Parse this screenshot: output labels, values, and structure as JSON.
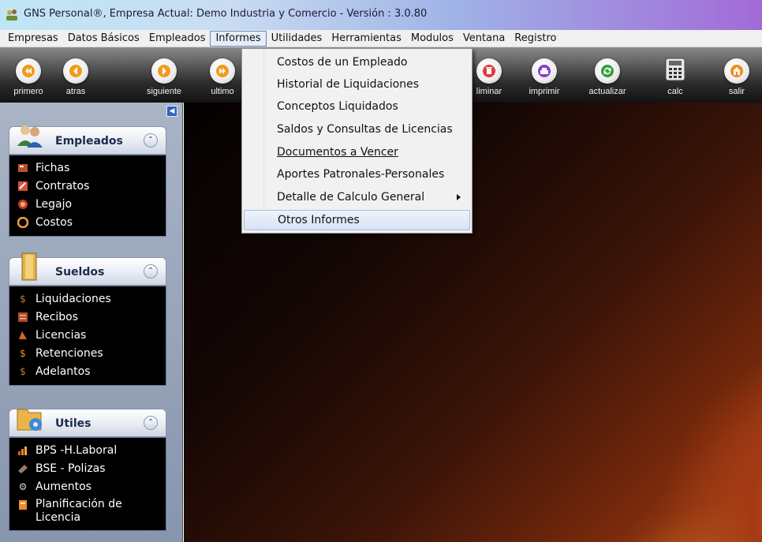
{
  "window": {
    "title": "GNS Personal®, Empresa Actual: Demo Industria y Comercio - Versión : 3.0.80"
  },
  "menubar": {
    "items": [
      "Empresas",
      "Datos Básicos",
      "Empleados",
      "Informes",
      "Utilidades",
      "Herramientas",
      "Modulos",
      "Ventana",
      "Registro"
    ],
    "active": "Informes"
  },
  "toolbar": {
    "buttons": [
      {
        "label": "primero",
        "icon": "first-icon",
        "color": "#f29a1c"
      },
      {
        "label": "atras",
        "icon": "back-icon",
        "color": "#f29a1c"
      },
      {
        "label": "siguiente",
        "icon": "next-icon",
        "color": "#f29a1c"
      },
      {
        "label": "ultimo",
        "icon": "last-icon",
        "color": "#f29a1c"
      },
      {
        "label": "eliminar",
        "icon": "delete-icon",
        "color": "#e03a3a"
      },
      {
        "label": "imprimir",
        "icon": "print-icon",
        "color": "#8a3ed0"
      },
      {
        "label": "actualizar",
        "icon": "refresh-icon",
        "color": "#2f9e3a"
      },
      {
        "label": "calc",
        "icon": "calculator-icon",
        "color": "#555555"
      },
      {
        "label": "salir",
        "icon": "exit-icon",
        "color": "#f28c1c"
      }
    ],
    "visible_labels": {
      "ultimo": "ultimo",
      "eliminar": "liminar"
    }
  },
  "informes_menu": {
    "items": [
      {
        "label": "Costos de un Empleado"
      },
      {
        "label": "Historial de Liquidaciones"
      },
      {
        "label": "Conceptos Liquidados"
      },
      {
        "label": "Saldos y Consultas de Licencias"
      },
      {
        "label": "Documentos a Vencer",
        "underline_first": true
      },
      {
        "label": "Aportes Patronales-Personales"
      },
      {
        "label": "Detalle de Calculo General",
        "submenu": true
      },
      {
        "label": "Otros Informes",
        "highlighted": true
      }
    ]
  },
  "sidebar": {
    "groups": [
      {
        "title": "Empleados",
        "icon": "people-icon",
        "items": [
          {
            "label": "Fichas",
            "icon": "card-icon"
          },
          {
            "label": "Contratos",
            "icon": "contract-icon"
          },
          {
            "label": "Legajo",
            "icon": "folder-icon"
          },
          {
            "label": "Costos",
            "icon": "cost-icon"
          }
        ]
      },
      {
        "title": "Sueldos",
        "icon": "binder-icon",
        "items": [
          {
            "label": "Liquidaciones",
            "icon": "dollar-icon"
          },
          {
            "label": "Recibos",
            "icon": "receipt-icon"
          },
          {
            "label": "Licencias",
            "icon": "license-icon"
          },
          {
            "label": "Retenciones",
            "icon": "dollar-icon"
          },
          {
            "label": "Adelantos",
            "icon": "dollar-icon"
          }
        ]
      },
      {
        "title": "Utiles",
        "icon": "folder-gear-icon",
        "items": [
          {
            "label": "BPS -H.Laboral",
            "icon": "chart-icon"
          },
          {
            "label": "BSE - Polizas",
            "icon": "policy-icon"
          },
          {
            "label": "Aumentos",
            "icon": "gear-icon"
          },
          {
            "label": "Planificación de Licencia",
            "icon": "planning-icon"
          }
        ]
      }
    ]
  }
}
